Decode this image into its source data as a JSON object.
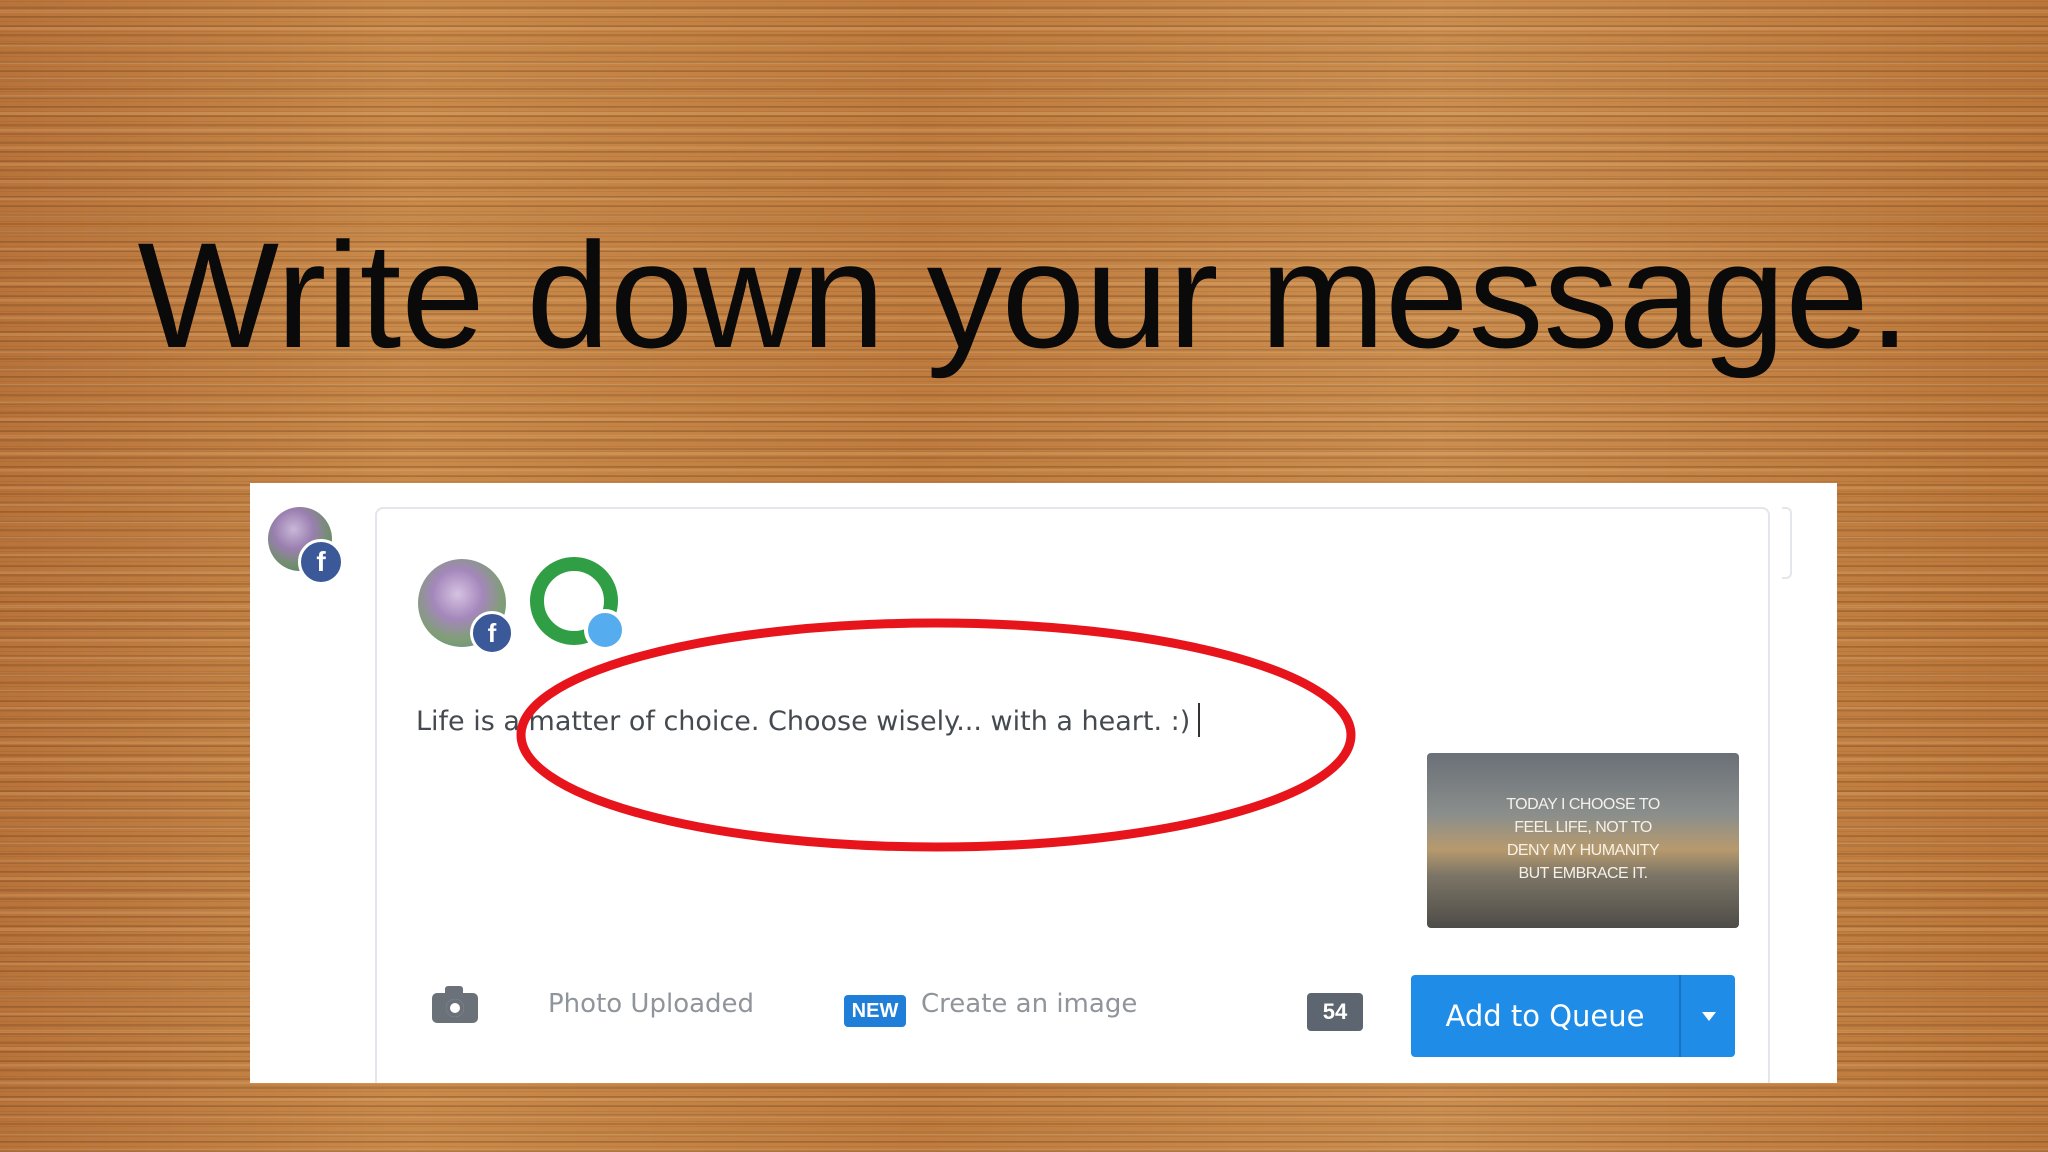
{
  "slide": {
    "title": "Write down your message."
  },
  "composer": {
    "accounts": [
      {
        "name": "facebook-profile",
        "network_icon": "facebook-icon",
        "badge_letter": "f"
      },
      {
        "name": "q-profile",
        "network_icon": "twitter-icon"
      }
    ],
    "side_avatar_badge_letter": "f",
    "message": "Life is a matter of choice. Choose wisely... with a heart. :)",
    "attachment_thumbnail": {
      "quote_lines": [
        "TODAY I CHOOSE TO",
        "FEEL LIFE, NOT TO",
        "DENY MY HUMANITY",
        "BUT EMBRACE IT."
      ]
    },
    "footer": {
      "camera_icon": "camera-icon",
      "photo_label": "Photo Uploaded",
      "new_badge": "NEW",
      "create_image_label": "Create an image",
      "char_count": "54",
      "add_button_label": "Add to Queue",
      "dropdown_icon": "caret-down-icon"
    }
  },
  "colors": {
    "highlight_ellipse": "#e8141c",
    "primary_button": "#1f8de8",
    "new_badge": "#1f7fd8",
    "facebook": "#3b5998",
    "twitter": "#55acee",
    "q_ring": "#2f9e44"
  }
}
